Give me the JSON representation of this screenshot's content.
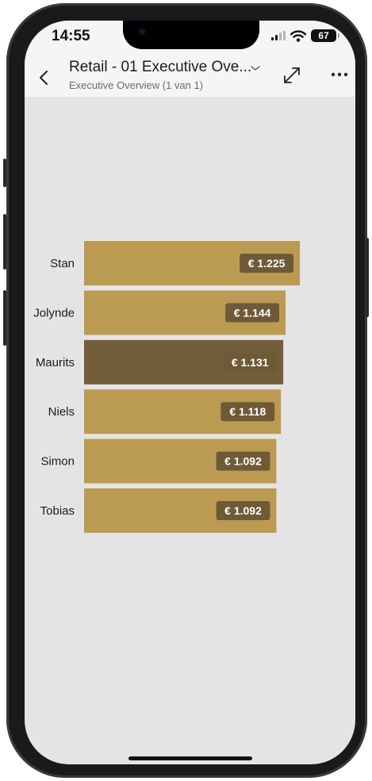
{
  "status_bar": {
    "time": "14:55",
    "battery": "67",
    "icons": [
      "signal-icon",
      "wifi-icon",
      "battery-icon"
    ]
  },
  "header": {
    "title": "Retail - 01 Executive Ove...",
    "subtitle": "Executive Overview (1 van 1)",
    "icons": [
      "chevron-left-icon",
      "chevron-down-icon",
      "expand-icon",
      "more-icon"
    ]
  },
  "colors": {
    "bar": "#bb9a52",
    "bar_highlight": "#735e3a",
    "label_bg": "#6e5a37",
    "label_text": "#ffffff",
    "canvas": "#e5e4e5"
  },
  "chart_data": {
    "type": "bar",
    "orientation": "horizontal",
    "title": "",
    "xlabel": "",
    "ylabel": "",
    "categories": [
      "Stan",
      "Jolynde",
      "Maurits",
      "Niels",
      "Simon",
      "Tobias"
    ],
    "values": [
      1225,
      1144,
      1131,
      1118,
      1092,
      1092
    ],
    "value_labels": [
      "€ 1.225",
      "€ 1.144",
      "€ 1.131",
      "€ 1.118",
      "€ 1.092",
      "€ 1.092"
    ],
    "highlighted": "Maurits",
    "grid": false,
    "legend": "none"
  }
}
